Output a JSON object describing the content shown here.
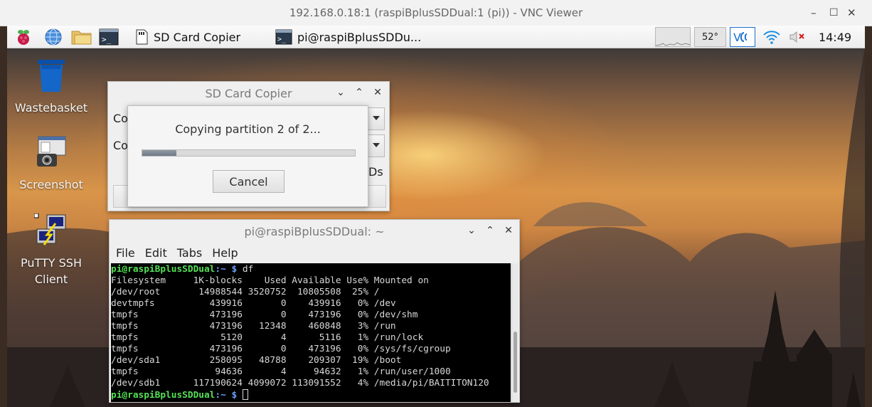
{
  "vnc": {
    "title": "192.168.0.18:1 (raspiBplusSDDual:1 (pi)) - VNC Viewer",
    "minimize": "–",
    "maximize": "☐",
    "close": "✕"
  },
  "taskbar": {
    "launchers": [
      {
        "name": "raspberry-menu-icon"
      },
      {
        "name": "web-browser-icon"
      },
      {
        "name": "file-manager-icon"
      },
      {
        "name": "terminal-icon"
      }
    ],
    "tasks": [
      {
        "label": "SD Card Copier",
        "icon": "sd-card-copier-icon"
      },
      {
        "label": "pi@raspiBplusSDDu...",
        "icon": "terminal-icon"
      }
    ],
    "cpu_temp": "52°",
    "clock": "14:49"
  },
  "desktop_icons": [
    {
      "label": "Wastebasket",
      "icon": "wastebasket-icon"
    },
    {
      "label": "Screenshot",
      "icon": "screenshot-icon"
    },
    {
      "label_line1": "PuTTY SSH",
      "label_line2": "Client",
      "icon": "putty-icon"
    }
  ],
  "sd_copier": {
    "title": "SD Card Copier",
    "copy_from_partial": "Co",
    "copy_to_partial": "Co",
    "uuids_partial": "Ds",
    "minimize": "⌄",
    "maximize": "⌃",
    "close": "✕"
  },
  "progress": {
    "message": "Copying partition 2 of 2...",
    "value": 0.16,
    "cancel_label": "Cancel"
  },
  "terminal": {
    "title": "pi@raspiBplusSDDual: ~",
    "minimize": "⌄",
    "maximize": "⌃",
    "close": "✕",
    "menu": [
      "File",
      "Edit",
      "Tabs",
      "Help"
    ],
    "prompt_user": "pi@raspiBplusSDDual",
    "prompt_path": ":~ $",
    "command": " df",
    "output": [
      "Filesystem     1K-blocks    Used Available Use% Mounted on",
      "/dev/root       14988544 3520752  10805508  25% /",
      "devtmpfs          439916       0    439916   0% /dev",
      "tmpfs             473196       0    473196   0% /dev/shm",
      "tmpfs             473196   12348    460848   3% /run",
      "tmpfs               5120       4      5116   1% /run/lock",
      "tmpfs             473196       0    473196   0% /sys/fs/cgroup",
      "/dev/sda1         258095   48788    209307  19% /boot",
      "tmpfs              94636       4     94632   1% /run/user/1000",
      "/dev/sdb1      117190624 4099072 113091552   4% /media/pi/BAITITON120"
    ]
  },
  "colors": {
    "prompt_green": "#55e055",
    "path_blue": "#6aa2ff",
    "vnc_blue": "#1a6fd0"
  }
}
